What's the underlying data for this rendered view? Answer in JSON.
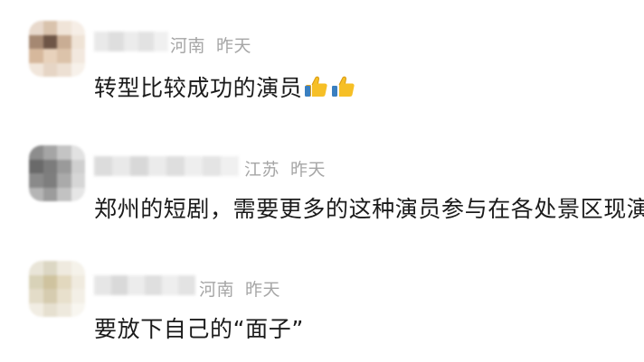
{
  "comments": [
    {
      "location": "河南",
      "time": "昨天",
      "text": "转型比较成功的演员",
      "emoji": [
        "thumbs-up",
        "thumbs-up"
      ]
    },
    {
      "location": "江苏",
      "time": "昨天",
      "text": "郑州的短剧，需要更多的这种演员参与在各处景区现演"
    },
    {
      "location": "河南",
      "time": "昨天",
      "text": "要放下自己的“面子”"
    }
  ]
}
